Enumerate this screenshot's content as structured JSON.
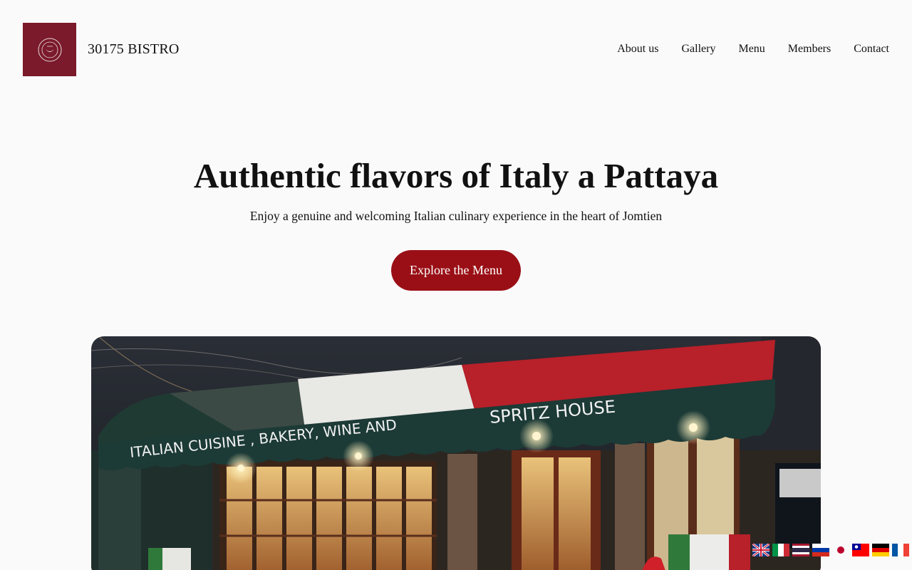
{
  "header": {
    "brand": "30175 BISTRO",
    "logo_alt": "30175 Bistro logo",
    "nav": [
      {
        "label": "About us"
      },
      {
        "label": "Gallery"
      },
      {
        "label": "Menu"
      },
      {
        "label": "Members"
      },
      {
        "label": "Contact"
      }
    ]
  },
  "hero": {
    "title": "Authentic flavors of Italy a Pattaya",
    "subtitle": "Enjoy a genuine and welcoming Italian culinary experience in the heart of Jomtien",
    "cta_label": "Explore the Menu"
  },
  "photo": {
    "awning_text_left": "ITALIAN  CUISINE , BAKERY, WINE AND",
    "awning_text_right": "SPRITZ   HOUSE"
  },
  "language_flags": [
    {
      "lang": "English",
      "icon": "uk-flag-icon"
    },
    {
      "lang": "Italian",
      "icon": "italy-flag-icon"
    },
    {
      "lang": "Thai",
      "icon": "thailand-flag-icon"
    },
    {
      "lang": "Russian",
      "icon": "russia-flag-icon"
    },
    {
      "lang": "Japanese",
      "icon": "japan-flag-icon"
    },
    {
      "lang": "Chinese",
      "icon": "taiwan-flag-icon"
    },
    {
      "lang": "German",
      "icon": "germany-flag-icon"
    },
    {
      "lang": "French",
      "icon": "france-flag-icon"
    }
  ],
  "colors": {
    "background": "#fafafa",
    "logo_bg": "#7a1a2a",
    "cta_bg": "#9a0f16",
    "text": "#111111"
  }
}
